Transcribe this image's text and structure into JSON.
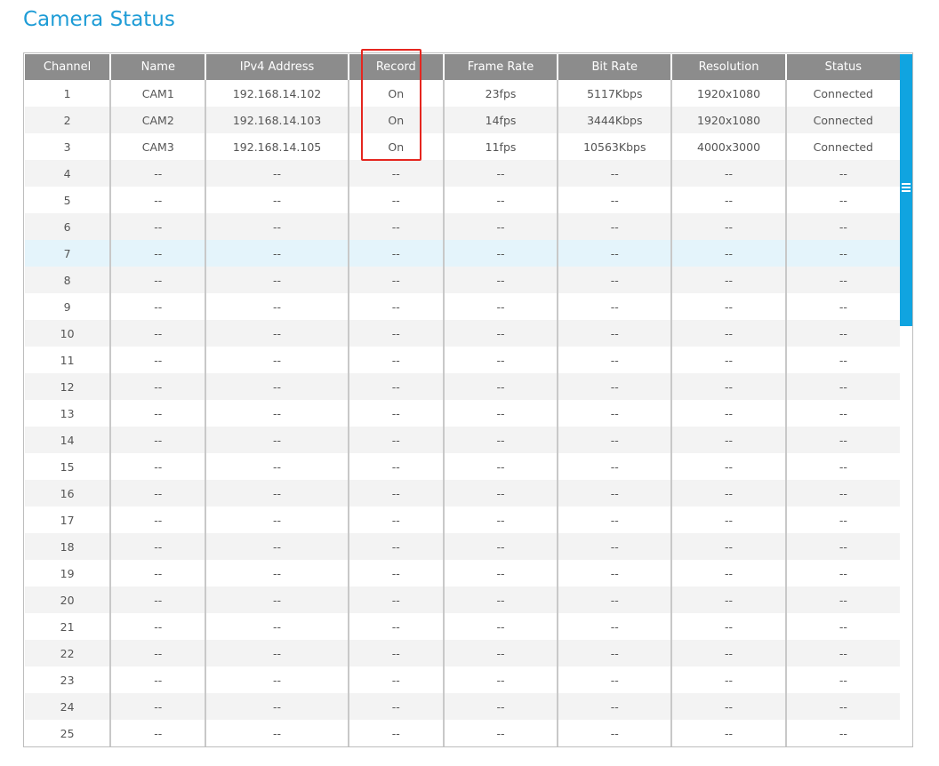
{
  "page": {
    "title": "Camera Status"
  },
  "table": {
    "columns": [
      "Channel",
      "Name",
      "IPv4 Address",
      "Record",
      "Frame Rate",
      "Bit Rate",
      "Resolution",
      "Status"
    ],
    "rows": [
      [
        "1",
        "CAM1",
        "192.168.14.102",
        "On",
        "23fps",
        "5117Kbps",
        "1920x1080",
        "Connected"
      ],
      [
        "2",
        "CAM2",
        "192.168.14.103",
        "On",
        "14fps",
        "3444Kbps",
        "1920x1080",
        "Connected"
      ],
      [
        "3",
        "CAM3",
        "192.168.14.105",
        "On",
        "11fps",
        "10563Kbps",
        "4000x3000",
        "Connected"
      ],
      [
        "4",
        "--",
        "--",
        "--",
        "--",
        "--",
        "--",
        "--"
      ],
      [
        "5",
        "--",
        "--",
        "--",
        "--",
        "--",
        "--",
        "--"
      ],
      [
        "6",
        "--",
        "--",
        "--",
        "--",
        "--",
        "--",
        "--"
      ],
      [
        "7",
        "--",
        "--",
        "--",
        "--",
        "--",
        "--",
        "--"
      ],
      [
        "8",
        "--",
        "--",
        "--",
        "--",
        "--",
        "--",
        "--"
      ],
      [
        "9",
        "--",
        "--",
        "--",
        "--",
        "--",
        "--",
        "--"
      ],
      [
        "10",
        "--",
        "--",
        "--",
        "--",
        "--",
        "--",
        "--"
      ],
      [
        "11",
        "--",
        "--",
        "--",
        "--",
        "--",
        "--",
        "--"
      ],
      [
        "12",
        "--",
        "--",
        "--",
        "--",
        "--",
        "--",
        "--"
      ],
      [
        "13",
        "--",
        "--",
        "--",
        "--",
        "--",
        "--",
        "--"
      ],
      [
        "14",
        "--",
        "--",
        "--",
        "--",
        "--",
        "--",
        "--"
      ],
      [
        "15",
        "--",
        "--",
        "--",
        "--",
        "--",
        "--",
        "--"
      ],
      [
        "16",
        "--",
        "--",
        "--",
        "--",
        "--",
        "--",
        "--"
      ],
      [
        "17",
        "--",
        "--",
        "--",
        "--",
        "--",
        "--",
        "--"
      ],
      [
        "18",
        "--",
        "--",
        "--",
        "--",
        "--",
        "--",
        "--"
      ],
      [
        "19",
        "--",
        "--",
        "--",
        "--",
        "--",
        "--",
        "--"
      ],
      [
        "20",
        "--",
        "--",
        "--",
        "--",
        "--",
        "--",
        "--"
      ],
      [
        "21",
        "--",
        "--",
        "--",
        "--",
        "--",
        "--",
        "--"
      ],
      [
        "22",
        "--",
        "--",
        "--",
        "--",
        "--",
        "--",
        "--"
      ],
      [
        "23",
        "--",
        "--",
        "--",
        "--",
        "--",
        "--",
        "--"
      ],
      [
        "24",
        "--",
        "--",
        "--",
        "--",
        "--",
        "--",
        "--"
      ],
      [
        "25",
        "--",
        "--",
        "--",
        "--",
        "--",
        "--",
        "--"
      ]
    ],
    "selected_row_channel": "7"
  },
  "colors": {
    "title": "#1e9cd6",
    "header_bg": "#8c8c8c",
    "scrollbar_thumb": "#10a4e0",
    "highlight_box": "#e5261f",
    "selected_row_bg": "#e4f4fb"
  },
  "icons": {
    "scroll_grip": "menu-lines-icon"
  }
}
